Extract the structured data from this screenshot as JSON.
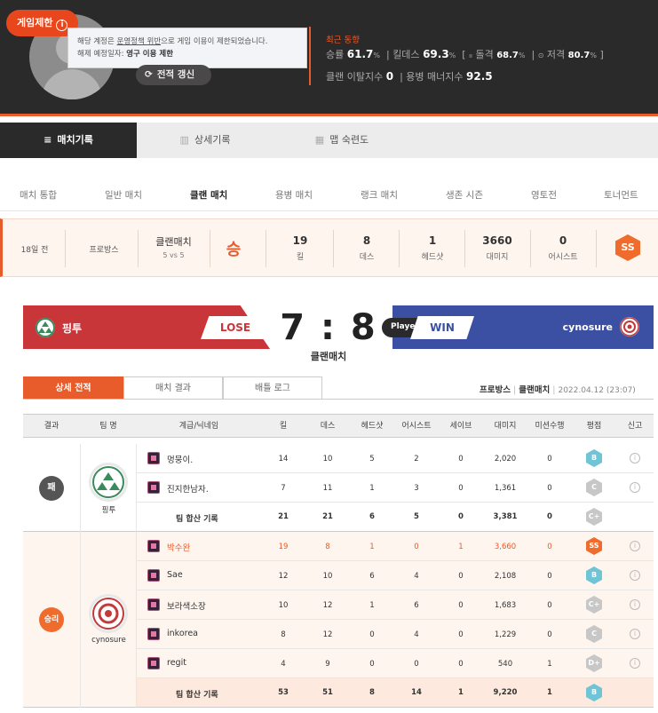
{
  "profile": {
    "ban_badge": "게임제한",
    "tooltip_line1_pre": "해당 계정은 ",
    "tooltip_line1_link": "운영정책 위반",
    "tooltip_line1_post": "으로 게임 이용이 제한되었습니다.",
    "tooltip_line2_label": "해제 예정일자: ",
    "tooltip_line2_value": "영구 이용 제한",
    "refresh_label": "전적 갱신",
    "recent_title": "최근 동향",
    "winrate_label": "승률",
    "winrate_value": "61.7",
    "kd_label": "킬데스",
    "kd_value": "69.3",
    "assault_label": "돌격",
    "assault_value": "68.7",
    "sniper_label": "저격",
    "sniper_value": "80.7",
    "percent": "%",
    "clan_leave_label": "클랜 이탈지수",
    "clan_leave_value": "0",
    "merc_label": "용병 매너지수",
    "merc_value": "92.5"
  },
  "main_tabs": [
    {
      "label": "매치기록",
      "icon": "list-icon"
    },
    {
      "label": "상세기록",
      "icon": "bar-chart-icon"
    },
    {
      "label": "맵 숙련도",
      "icon": "map-icon"
    }
  ],
  "sub_tabs": [
    "매치 통합",
    "일반 매치",
    "클랜 매치",
    "용병 매치",
    "랭크 매치",
    "생존 시즌",
    "영토전",
    "토너먼트"
  ],
  "summary": {
    "time": "18일 전",
    "map": "프로방스",
    "mode": "클랜매치",
    "mode_sub": "5 vs 5",
    "result": "승",
    "kills": "19",
    "kills_label": "킬",
    "deaths": "8",
    "deaths_label": "데스",
    "headshots": "1",
    "headshots_label": "헤드샷",
    "damage": "3660",
    "damage_label": "대미지",
    "assists": "0",
    "assists_label": "어시스트",
    "grade": "SS"
  },
  "banner": {
    "left_clan": "핑투",
    "left_result": "LOSE",
    "score": "7 : 8",
    "mode": "클랜매치",
    "player_tag": "Player",
    "right_result": "WIN",
    "right_clan": "cynosure"
  },
  "detail_tabs": [
    "상세 전적",
    "매치 결과",
    "배틀 로그"
  ],
  "match_meta": {
    "map": "프로방스",
    "mode": "클랜매치",
    "datetime": "2022.04.12 (23:07)"
  },
  "table": {
    "headers": [
      "결과",
      "팀 명",
      "계급/닉네임",
      "킬",
      "데스",
      "헤드샷",
      "어시스트",
      "세이브",
      "대미지",
      "미션수행",
      "평점",
      "신고"
    ],
    "team_total_label": "팀 합산 기록",
    "teams": [
      {
        "result": "패",
        "name": "핑투",
        "players": [
          {
            "name": "멍뭉이.",
            "k": "14",
            "d": "10",
            "hs": "5",
            "a": "2",
            "sv": "0",
            "dmg": "2,020",
            "ms": "0",
            "grade": "B"
          },
          {
            "name": "진지한남자.",
            "k": "7",
            "d": "11",
            "hs": "1",
            "a": "3",
            "sv": "0",
            "dmg": "1,361",
            "ms": "0",
            "grade": "C"
          }
        ],
        "total": {
          "k": "21",
          "d": "21",
          "hs": "6",
          "a": "5",
          "sv": "0",
          "dmg": "3,381",
          "ms": "0",
          "grade": "C+"
        }
      },
      {
        "result": "승리",
        "name": "cynosure",
        "players": [
          {
            "name": "박수완",
            "k": "19",
            "d": "8",
            "hs": "1",
            "a": "0",
            "sv": "1",
            "dmg": "3,660",
            "ms": "0",
            "grade": "SS"
          },
          {
            "name": "Sae",
            "k": "12",
            "d": "10",
            "hs": "6",
            "a": "4",
            "sv": "0",
            "dmg": "2,108",
            "ms": "0",
            "grade": "B"
          },
          {
            "name": "보라색소장",
            "k": "10",
            "d": "12",
            "hs": "1",
            "a": "6",
            "sv": "0",
            "dmg": "1,683",
            "ms": "0",
            "grade": "C+"
          },
          {
            "name": "inkorea",
            "k": "8",
            "d": "12",
            "hs": "0",
            "a": "4",
            "sv": "0",
            "dmg": "1,229",
            "ms": "0",
            "grade": "C"
          },
          {
            "name": "regit",
            "k": "4",
            "d": "9",
            "hs": "0",
            "a": "0",
            "sv": "0",
            "dmg": "540",
            "ms": "1",
            "grade": "D+"
          }
        ],
        "total": {
          "k": "53",
          "d": "51",
          "hs": "8",
          "a": "14",
          "sv": "1",
          "dmg": "9,220",
          "ms": "1",
          "grade": "B"
        }
      }
    ]
  },
  "colors": {
    "accent": "#e85b2a",
    "lose": "#c8363a",
    "win": "#3b4fa3",
    "grade_b": "#6fc5d6",
    "grade_c": "#c7c7c7",
    "grade_ss": "#ef6c2c"
  }
}
